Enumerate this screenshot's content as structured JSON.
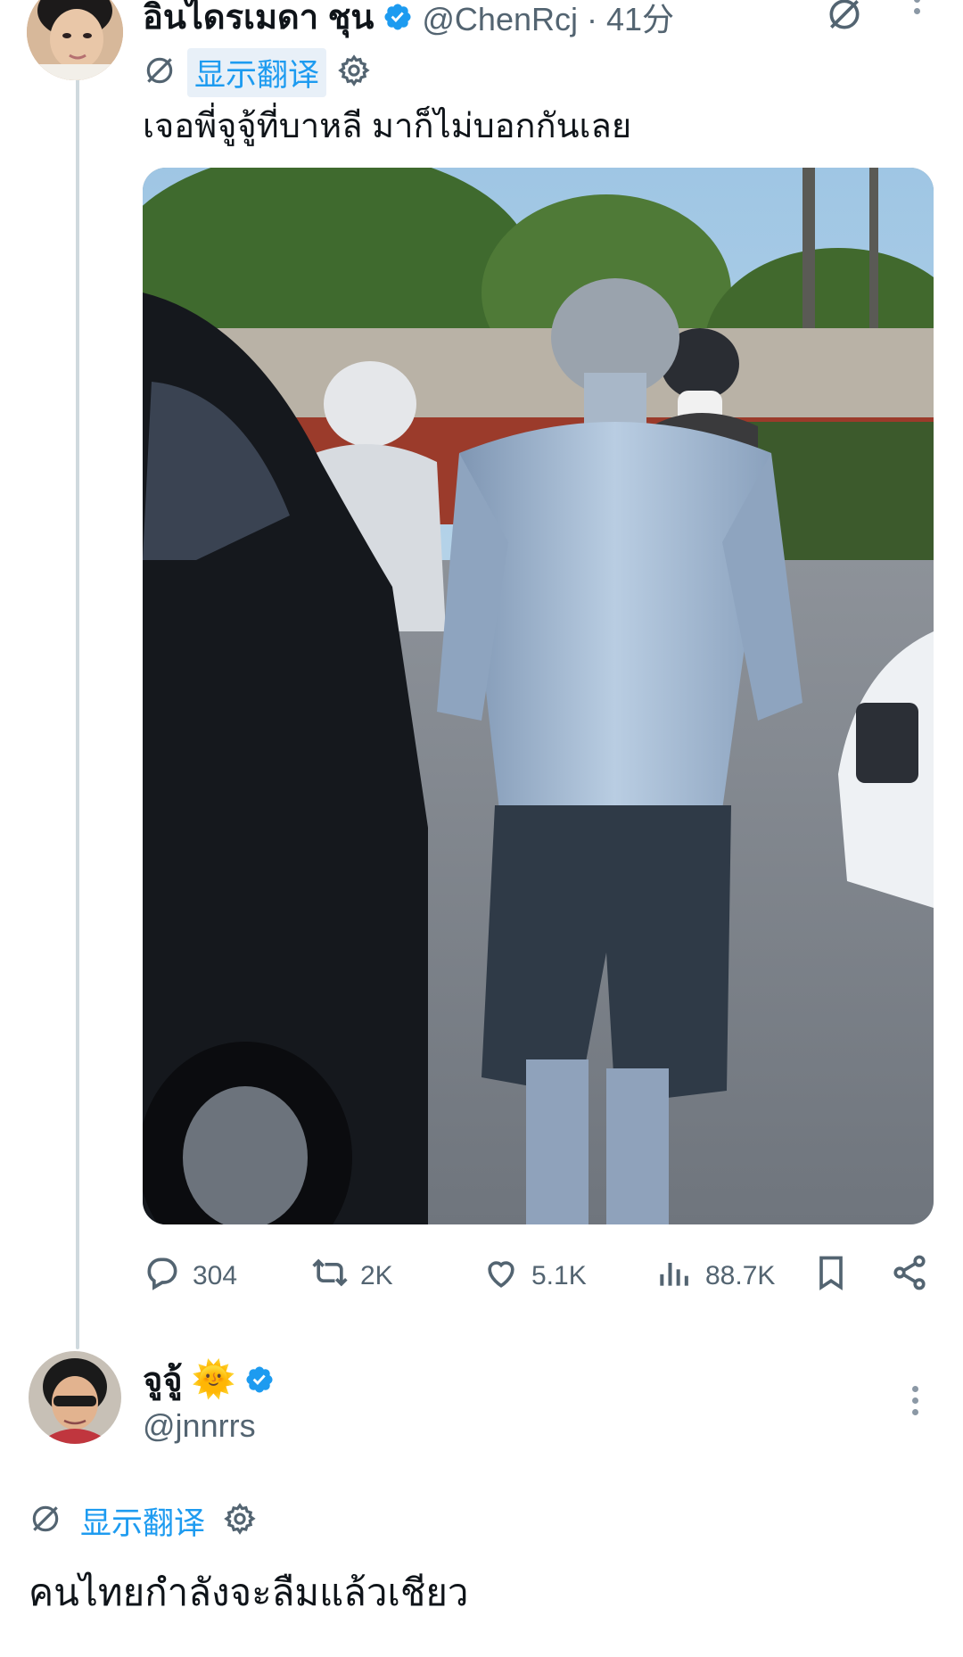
{
  "tweet1": {
    "display_name": "อินไดรเมดา ชุน",
    "handle_time": "@ChenRcj · 41分",
    "translate_label": "显示翻译",
    "text": "เจอพี่จูจู้ที่บาหลี มาก็ไม่บอกกันเลย",
    "stats": {
      "replies": "304",
      "retweets": "2K",
      "likes": "5.1K",
      "views": "88.7K"
    }
  },
  "tweet2": {
    "display_name": "จูจู้",
    "emoji": "🌞",
    "handle": "@jnnrrs",
    "translate_label": "显示翻译",
    "text": "คนไทยกำลังจะลืมแล้วเชียว"
  },
  "colors": {
    "accent": "#1d9bf0",
    "secondary_text": "#536471",
    "thread_line": "#cfd9de"
  },
  "icons": [
    "grok-icon",
    "more-icon",
    "translate-icon",
    "gear-icon",
    "reply-icon",
    "retweet-icon",
    "like-icon",
    "views-icon",
    "bookmark-icon",
    "share-icon",
    "verified-badge-icon"
  ]
}
